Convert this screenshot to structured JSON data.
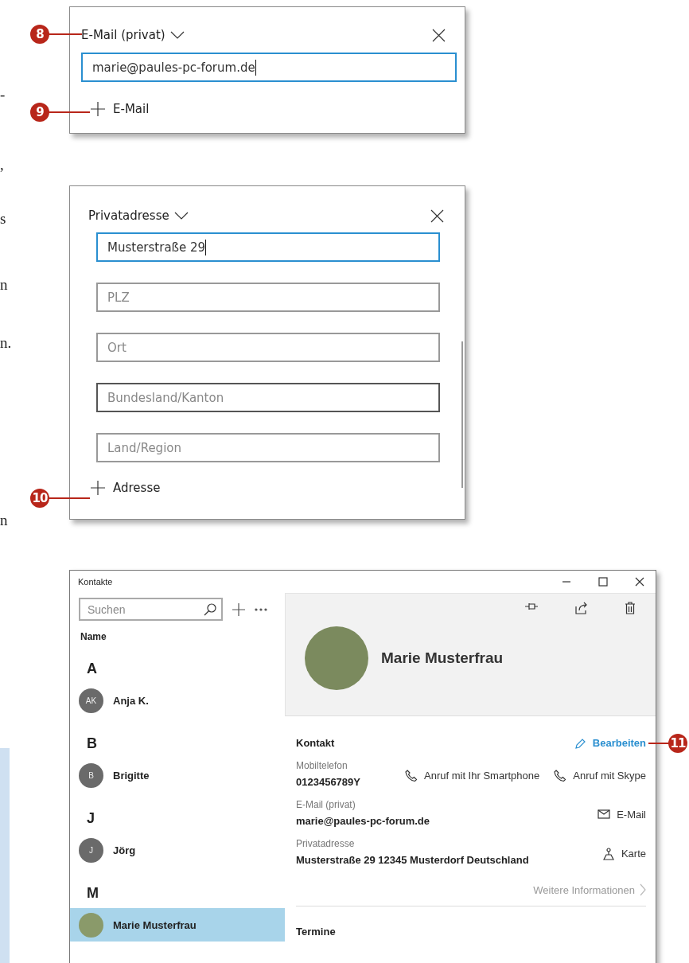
{
  "margin_text": [
    "-",
    ",",
    "s",
    "n",
    "n.",
    "n"
  ],
  "email_panel": {
    "title": "E-Mail (privat)",
    "field": {
      "value": "marie@paules-pc-forum.de",
      "focused": true
    },
    "add_label": "E-Mail",
    "callouts": [
      "8",
      "9"
    ]
  },
  "address_panel": {
    "title": "Privatadresse",
    "fields": [
      {
        "value": "Musterstraße 29",
        "focused": true,
        "hovered": false
      },
      {
        "placeholder": "PLZ",
        "focused": false,
        "hovered": false
      },
      {
        "placeholder": "Ort",
        "focused": false,
        "hovered": false
      },
      {
        "placeholder": "Bundesland/Kanton",
        "focused": false,
        "hovered": true
      },
      {
        "placeholder": "Land/Region",
        "focused": false,
        "hovered": false
      }
    ],
    "add_label": "Adresse",
    "callout": "10"
  },
  "window": {
    "title": "Kontakte",
    "sidebar": {
      "search": {
        "placeholder": "Suchen"
      },
      "sort_label": "Name",
      "groups": [
        {
          "letter": "A",
          "contacts": [
            {
              "name": "Anja K.",
              "initials": "AK",
              "kind": "initials",
              "selected": false
            }
          ]
        },
        {
          "letter": "B",
          "contacts": [
            {
              "name": "Brigitte",
              "initials": "B",
              "kind": "initials",
              "selected": false
            }
          ]
        },
        {
          "letter": "J",
          "contacts": [
            {
              "name": "Jörg",
              "initials": "J",
              "kind": "initials",
              "selected": false
            }
          ]
        },
        {
          "letter": "M",
          "contacts": [
            {
              "name": "Marie Musterfrau",
              "kind": "photo",
              "selected": true
            }
          ]
        }
      ]
    },
    "detail": {
      "name": "Marie Musterfrau",
      "section_title": "Kontakt",
      "edit_link": "Bearbeiten",
      "edit_callout": "11",
      "rows": [
        {
          "label": "Mobiltelefon",
          "value": "0123456789Y",
          "actions": [
            {
              "kind": "phone",
              "label": "Anruf mit Ihr Smartphone"
            },
            {
              "kind": "phone",
              "label": "Anruf mit Skype"
            }
          ]
        },
        {
          "label": "E-Mail (privat)",
          "value": "marie@paules-pc-forum.de",
          "actions": [
            {
              "kind": "mail",
              "label": "E-Mail"
            }
          ]
        },
        {
          "label": "Privatadresse",
          "value": "Musterstraße 29 12345 Musterdorf Deutschland",
          "actions": [
            {
              "kind": "map",
              "label": "Karte"
            }
          ]
        }
      ],
      "more_link": "Weitere Informationen",
      "next_section": "Termine"
    }
  }
}
